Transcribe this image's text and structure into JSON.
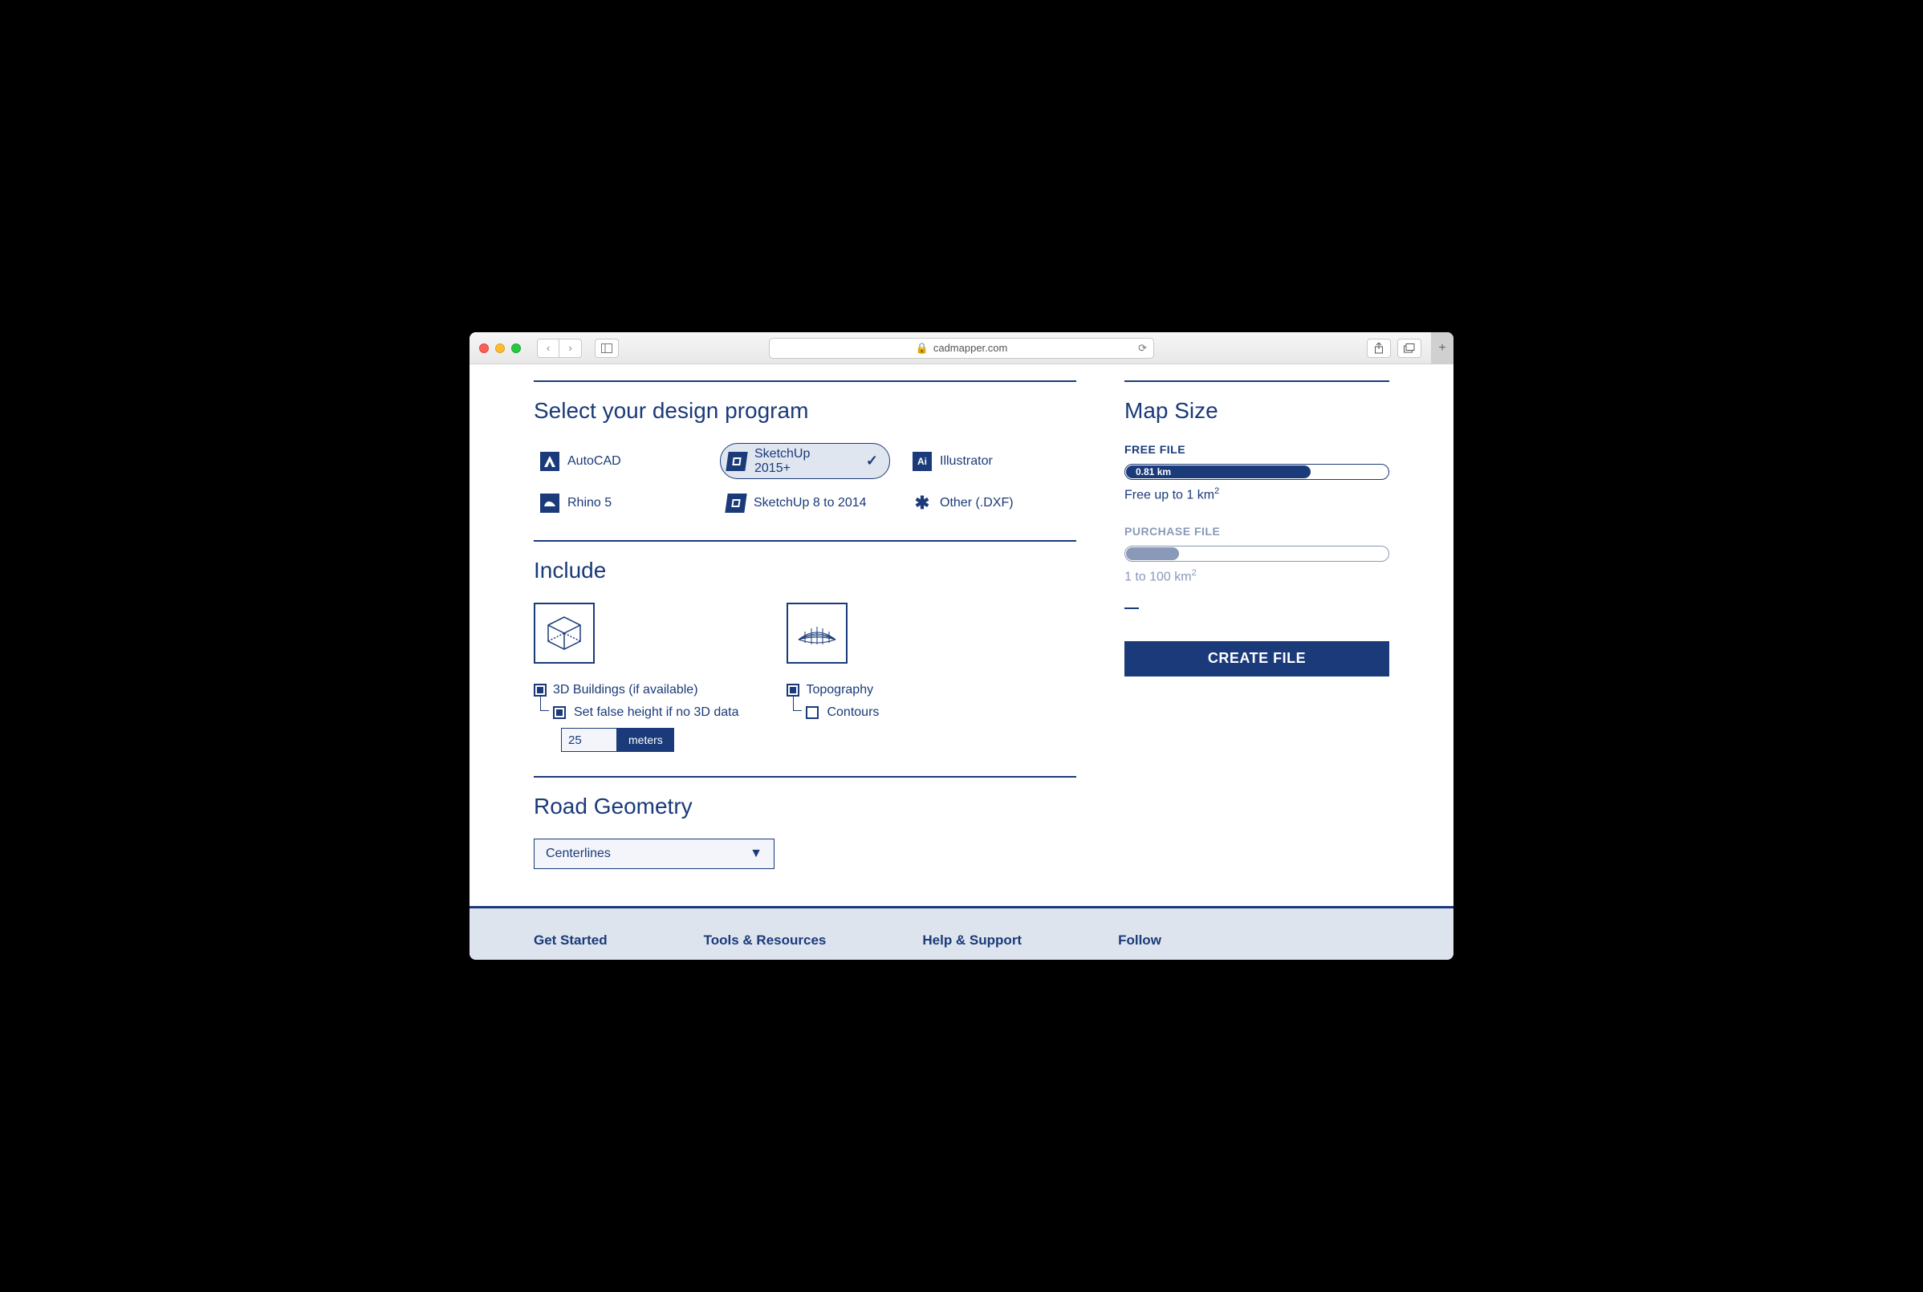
{
  "browser": {
    "domain": "cadmapper.com"
  },
  "main": {
    "select_program_title": "Select your design program",
    "programs": [
      {
        "label": "AutoCAD",
        "icon": "A"
      },
      {
        "label": "SketchUp 2015+",
        "icon": "S",
        "selected": true
      },
      {
        "label": "Illustrator",
        "icon": "Ai"
      },
      {
        "label": "Rhino 5",
        "icon": "R"
      },
      {
        "label": "SketchUp 8 to 2014",
        "icon": "S"
      },
      {
        "label": "Other (.DXF)",
        "icon": "✱"
      }
    ],
    "include_title": "Include",
    "buildings": {
      "label": "3D Buildings (if available)",
      "checked": true,
      "false_height_label": "Set false height if no 3D data",
      "false_height_checked": true,
      "height_value": "25",
      "height_unit": "meters"
    },
    "topo": {
      "label": "Topography",
      "checked": true,
      "contours_label": "Contours",
      "contours_checked": false
    },
    "road_title": "Road Geometry",
    "road_value": "Centerlines"
  },
  "sidebar": {
    "title": "Map Size",
    "free_label": "FREE FILE",
    "free_value": "0.81 km",
    "free_pct": 70,
    "free_note_prefix": "Free up to 1 km",
    "purchase_label": "PURCHASE FILE",
    "purchase_pct": 20,
    "purchase_note_prefix": "1 to 100 km",
    "create_label": "CREATE FILE"
  },
  "footer": {
    "cols": [
      "Get Started",
      "Tools & Resources",
      "Help & Support",
      "Follow"
    ]
  }
}
